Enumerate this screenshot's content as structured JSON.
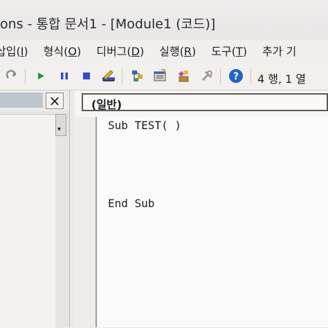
{
  "window": {
    "title": "ons - 통합 문서1 - [Module1 (코드)]"
  },
  "menu": [
    {
      "label": "삽입",
      "key": "I"
    },
    {
      "label": "형식",
      "key": "O"
    },
    {
      "label": "디버그",
      "key": "D"
    },
    {
      "label": "실행",
      "key": "R"
    },
    {
      "label": "도구",
      "key": "T"
    },
    {
      "label": "추가 기",
      "key": ""
    }
  ],
  "toolbar": {
    "cursor_position": "4 행, 1 열"
  },
  "left_pane": {
    "close_label": "×"
  },
  "editor": {
    "object_combo": "(일반)",
    "lines": [
      "Sub TEST( )",
      "End Sub"
    ]
  },
  "colors": {
    "run_green": "#1a9a3a",
    "pause_blue": "#2f4fc9",
    "help_blue": "#2262c6"
  }
}
